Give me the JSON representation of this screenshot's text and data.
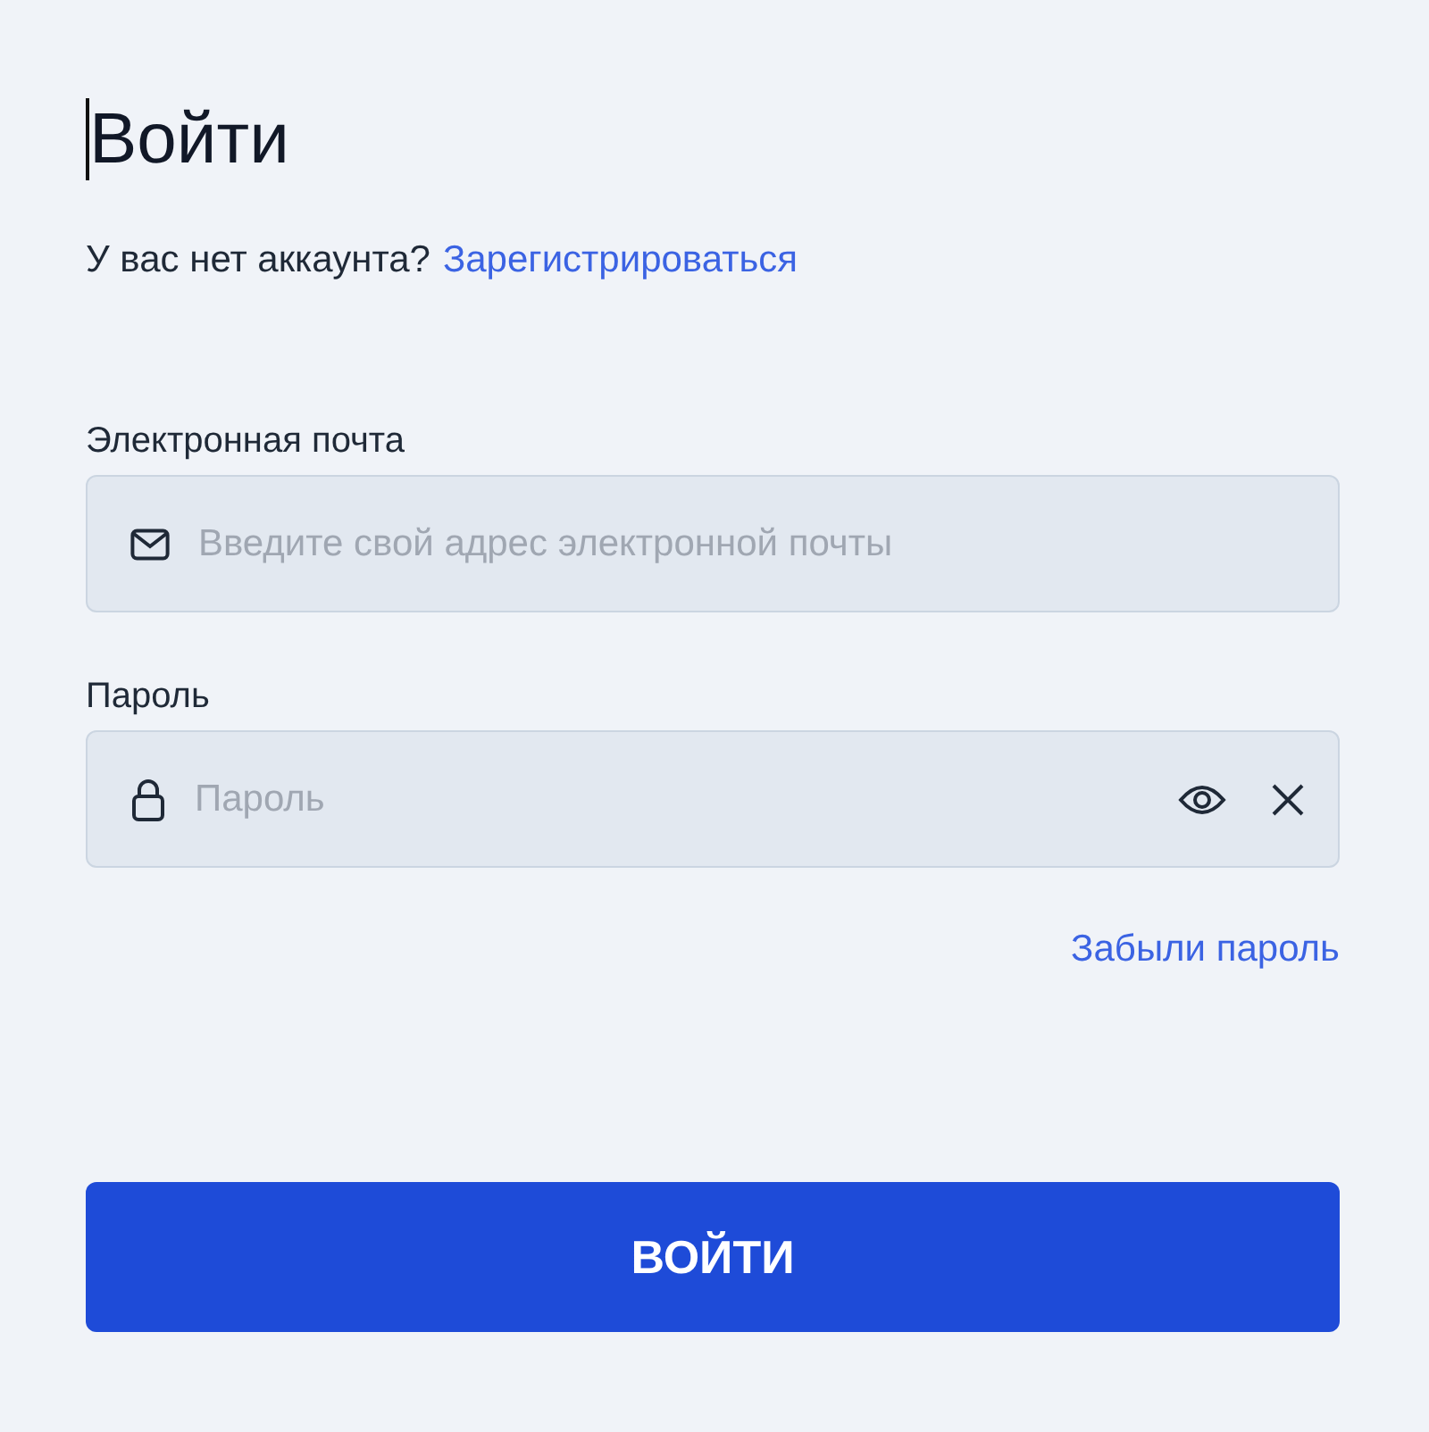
{
  "title": "Войти",
  "signup": {
    "prompt": "У вас нет аккаунта?",
    "link": "Зарегистрироваться"
  },
  "fields": [
    {
      "kind": "email",
      "label": "Электронная почта",
      "placeholder": "Введите свой адрес электронной почты"
    },
    {
      "kind": "password",
      "label": "Пароль",
      "placeholder": "Пароль"
    }
  ],
  "forgot_link": "Забыли пароль",
  "submit": "ВОЙТИ"
}
